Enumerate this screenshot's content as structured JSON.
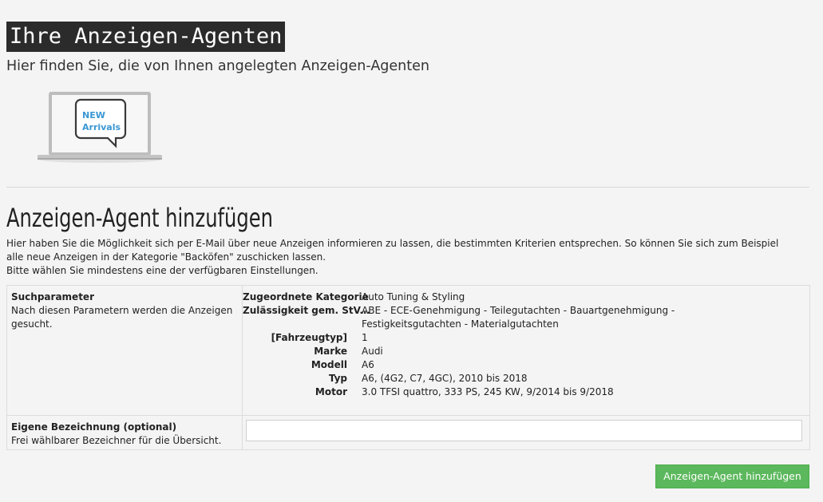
{
  "header": {
    "title": "Ihre Anzeigen-Agenten",
    "subtitle": "Hier finden Sie, die von Ihnen angelegten Anzeigen-Agenten"
  },
  "illustration": {
    "icon": "laptop-new-arrivals-icon",
    "line1": "NEW",
    "line2": "Arrivals",
    "accent_color": "#3a97d4"
  },
  "section": {
    "title": "Anzeigen-Agent hinzufügen",
    "intro_line1": "Hier haben Sie die Möglichkeit sich per E-Mail über neue Anzeigen informieren zu lassen, die bestimmten Kriterien entsprechen. So können Sie sich zum Beispiel",
    "intro_line2": "alle neue Anzeigen in der Kategorie \"Backöfen\" zuschicken lassen.",
    "intro_line3": "Bitte wählen Sie mindestens eine der verfügbaren Einstellungen."
  },
  "search_params": {
    "label": "Suchparameter",
    "description": "Nach diesen Parametern werden die Anzeigen gesucht.",
    "items": [
      {
        "key": "Zugeordnete Kategorie",
        "value": "Auto Tuning & Styling"
      },
      {
        "key": "Zulässigkeit gem. StV...",
        "value": "ABE - ECE-Genehmigung - Teilegutachten - Bauartgenehmigung - Festigkeitsgutachten - Materialgutachten"
      },
      {
        "key": "[Fahrzeugtyp]",
        "value": "1"
      },
      {
        "key": "Marke",
        "value": "Audi"
      },
      {
        "key": "Modell",
        "value": "A6"
      },
      {
        "key": "Typ",
        "value": "A6, (4G2, C7, 4GC), 2010 bis 2018"
      },
      {
        "key": "Motor",
        "value": "3.0 TFSI quattro, 333 PS, 245 KW, 9/2014 bis 9/2018"
      }
    ]
  },
  "custom_name": {
    "label": "Eigene Bezeichnung (optional)",
    "description": "Frei wählbarer Bezeichner für die Übersicht.",
    "value": "",
    "placeholder": ""
  },
  "actions": {
    "submit_label": "Anzeigen-Agent hinzufügen",
    "submit_color": "#5cb85c"
  }
}
